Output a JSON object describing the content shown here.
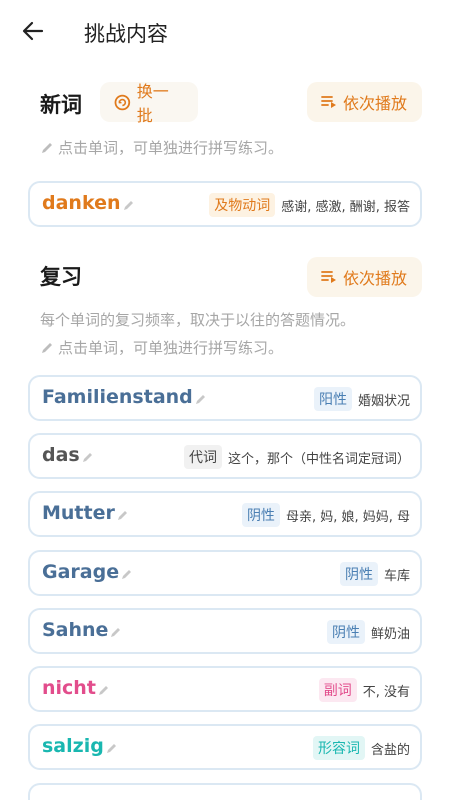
{
  "header": {
    "title": "挑战内容",
    "back_icon": "arrow-left-icon"
  },
  "new_words": {
    "title": "新词",
    "refresh_label": "换一批",
    "play_label": "依次播放",
    "hint": "点击单词，可单独进行拼写练习。",
    "items": [
      {
        "word": "danken",
        "pos": "及物动词",
        "meaning": "感谢, 感激, 酬谢, 报答",
        "color": "#e07a1c"
      }
    ]
  },
  "review": {
    "title": "复习",
    "play_label": "依次播放",
    "desc": "每个单词的复习频率，取决于以往的答题情况。",
    "hint": "点击单词，可单独进行拼写练习。",
    "items": [
      {
        "word": "Familienstand",
        "pos": "阳性",
        "meaning": "婚姻状况"
      },
      {
        "word": "das",
        "pos": "代词",
        "meaning": "这个，那个（中性名词定冠词）"
      },
      {
        "word": "Mutter",
        "pos": "阴性",
        "meaning": "母亲, 妈, 娘, 妈妈, 母"
      },
      {
        "word": "Garage",
        "pos": "阴性",
        "meaning": "车库"
      },
      {
        "word": "Sahne",
        "pos": "阴性",
        "meaning": "鲜奶油"
      },
      {
        "word": "nicht",
        "pos": "副词",
        "meaning": "不, 没有"
      },
      {
        "word": "salzig",
        "pos": "形容词",
        "meaning": "含盐的"
      }
    ]
  }
}
